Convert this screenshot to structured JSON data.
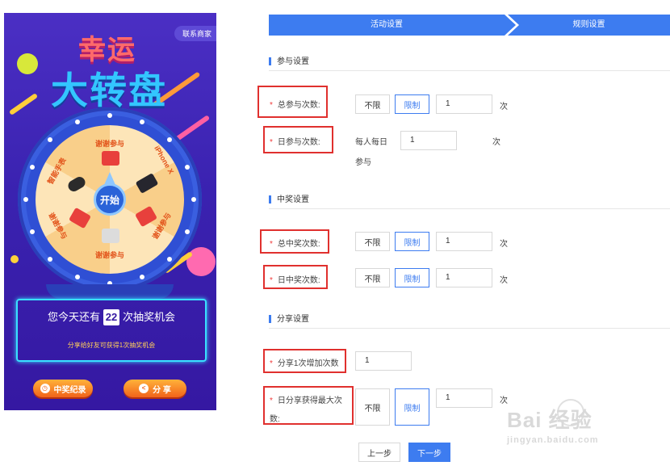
{
  "preview": {
    "contact_label": "联系商家",
    "title_line1": "幸运",
    "title_line2": "大转盘",
    "start_label": "开始",
    "prizes": [
      "谢谢参与",
      "iPhone X",
      "智能手表",
      "谢谢参与",
      "谢谢参与",
      "谢谢参与"
    ],
    "chance_prefix": "您今天还有",
    "chance_count": "22",
    "chance_suffix": "次抽奖机会",
    "share_hint": "分享给好友可获得1次抽奖机会",
    "records_button": "中奖纪录",
    "share_button": "分 享",
    "colors": {
      "bg": "#3a22b0",
      "accent": "#39e0ff",
      "button": "#f1631a"
    }
  },
  "steps": [
    "活动设置",
    "规则设置"
  ],
  "sections": {
    "participation": {
      "title": "参与设置",
      "total": {
        "label": "总参与次数:",
        "unlimited": "不限",
        "limited": "限制",
        "value": "1",
        "unit": "次"
      },
      "daily": {
        "label": "日参与次数:",
        "prefix_line1": "每人每日",
        "prefix_line2": "参与",
        "value": "1",
        "unit": "次"
      }
    },
    "winning": {
      "title": "中奖设置",
      "total": {
        "label": "总中奖次数:",
        "unlimited": "不限",
        "limited": "限制",
        "value": "1",
        "unit": "次"
      },
      "daily": {
        "label": "日中奖次数:",
        "unlimited": "不限",
        "limited": "限制",
        "value": "1",
        "unit": "次"
      }
    },
    "sharing": {
      "title": "分享设置",
      "per_share": {
        "label": "分享1次增加次数",
        "value": "1"
      },
      "daily_max": {
        "label_line1": "日分享获得最大次",
        "label_line2": "数:",
        "unlimited": "不限",
        "limited": "限制",
        "value": "1",
        "unit": "次"
      }
    }
  },
  "nav": {
    "prev": "上一步",
    "next": "下一步"
  },
  "watermark": {
    "brand": "Bai 经验",
    "url": "jingyan.baidu.com"
  },
  "accent_color": "#3d7cf0",
  "highlight_color": "#e0302e"
}
